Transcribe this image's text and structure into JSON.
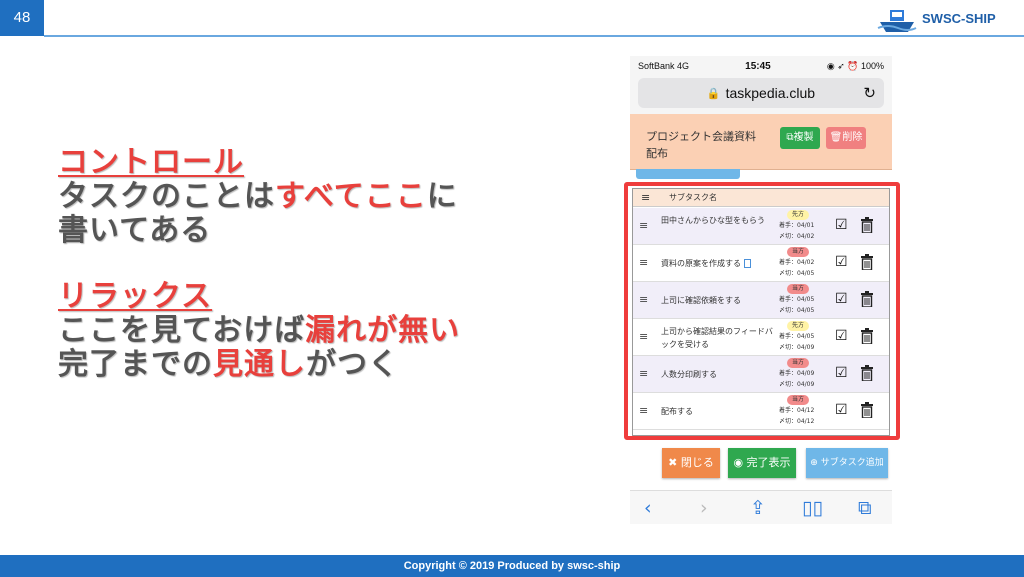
{
  "slide": {
    "number": "48",
    "brand": "SWSC-SHIP",
    "footer": "Copyright © 2019 Produced by swsc-ship"
  },
  "left_text": {
    "heading1": "コントロール",
    "line1_a": "タスクのことは",
    "line1_b": "すべてここ",
    "line1_c": "に",
    "line2": "書いてある",
    "heading2": "リラックス",
    "line3_a": "ここを見ておけば",
    "line3_b": "漏れが無い",
    "line4_a": "完了までの",
    "line4_b": "見通し",
    "line4_c": "がつく"
  },
  "phone": {
    "carrier": "SoftBank  4G",
    "time": "15:45",
    "status_right": "◉ ➶ ⏰ 100%",
    "url": "taskpedia.club",
    "task_title": "プロジェクト会議資料配布",
    "copy_label": "複製",
    "delete_label": "削除",
    "subtask_header": "サブタスク名",
    "close_label": "閉じる",
    "done_label": "完了表示",
    "add_label": "サブタスク追加",
    "rows": [
      {
        "name": "田中さんからひな型をもらう",
        "badge": "先方",
        "badge_color": "#fff3a6",
        "start": "着手：04/01",
        "due": "〆切：04/02"
      },
      {
        "name": "資料の原案を作成する",
        "badge": "当方",
        "badge_color": "#f28b8b",
        "start": "着手：04/02",
        "due": "〆切：04/05"
      },
      {
        "name": "上司に確認依頼をする",
        "badge": "当方",
        "badge_color": "#f28b8b",
        "start": "着手：04/05",
        "due": "〆切：04/05"
      },
      {
        "name": "上司から確認結果のフィードバックを受ける",
        "badge": "先方",
        "badge_color": "#fff3a6",
        "start": "着手：04/05",
        "due": "〆切：04/09"
      },
      {
        "name": "人数分印刷する",
        "badge": "当方",
        "badge_color": "#f28b8b",
        "start": "着手：04/09",
        "due": "〆切：04/09"
      },
      {
        "name": "配布する",
        "badge": "当方",
        "badge_color": "#f28b8b",
        "start": "着手：04/12",
        "due": "〆切：04/12"
      }
    ]
  },
  "colors": {
    "accent_red": "#e8403c",
    "brand_blue": "#1f6fc0"
  }
}
